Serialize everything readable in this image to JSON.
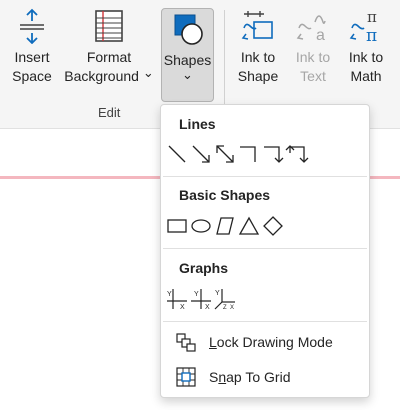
{
  "ribbon": {
    "insert_space": {
      "line1": "Insert",
      "line2": "Space"
    },
    "format_background": {
      "line1": "Format",
      "line2": "Background",
      "chevron": "⌄"
    },
    "shapes": {
      "label": "Shapes",
      "chevron": "⌄"
    },
    "group_label": "Edit",
    "ink_to_shape": {
      "line1": "Ink to",
      "line2": "Shape"
    },
    "ink_to_text": {
      "line1": "Ink to",
      "line2": "Text"
    },
    "ink_to_math": {
      "line1": "Ink to",
      "line2": "Math"
    },
    "colors": {
      "accent": "#0f6cbd",
      "disabled": "#a6a6a6",
      "page_line": "#f4b7bf"
    }
  },
  "menu": {
    "lines_title": "Lines",
    "basic_shapes_title": "Basic Shapes",
    "graphs_title": "Graphs",
    "lock_drawing_mode": {
      "prefix": "",
      "key": "L",
      "rest": "ock Drawing Mode"
    },
    "snap_to_grid": {
      "prefix": "S",
      "key": "n",
      "rest": "ap To Grid"
    },
    "graph_labels": {
      "y": "Y",
      "x": "X",
      "z": "Z"
    }
  }
}
